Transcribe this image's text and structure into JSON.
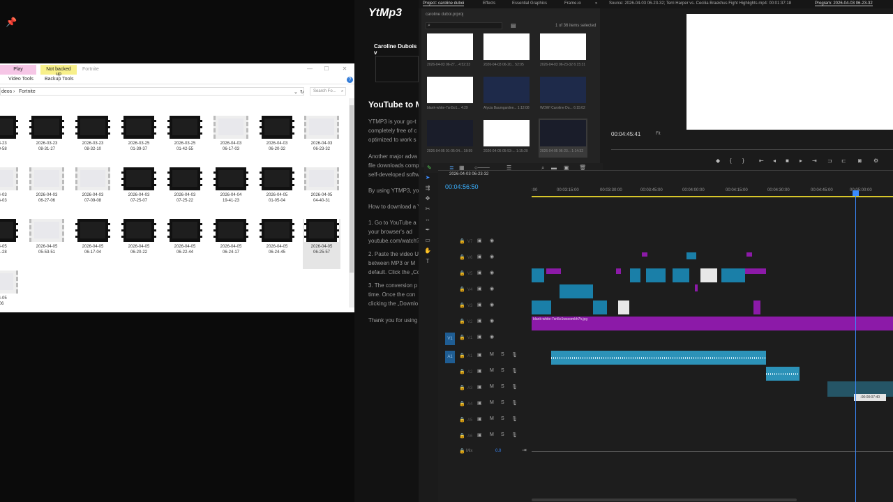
{
  "explorer": {
    "ctx_play": "Play",
    "ctx_backup": "Not backed up",
    "title": "Fortnite",
    "tabs": [
      "Video Tools",
      "Backup Tools"
    ],
    "breadcrumb_parent": "deos",
    "breadcrumb_sep": "›",
    "breadcrumb_current": "Fortnite",
    "search_placeholder": "Search Fo...",
    "files": [
      {
        "label": "-03-23\n-30-58",
        "light": false
      },
      {
        "label": "2026-03-23\n08-31-27",
        "light": false
      },
      {
        "label": "2026-03-23\n08-32-10",
        "light": false
      },
      {
        "label": "2026-03-25\n01-39-37",
        "light": false
      },
      {
        "label": "2026-03-25\n01-42-55",
        "light": false
      },
      {
        "label": "2026-04-03\n06-17-03",
        "light": true
      },
      {
        "label": "2026-04-03\n06-20-32",
        "light": false
      },
      {
        "label": "2026-04-03\n06-23-32",
        "light": true
      },
      {
        "label": "-04-03\n-26-03",
        "light": true
      },
      {
        "label": "2026-04-03\n06-27-06",
        "light": true
      },
      {
        "label": "2026-04-03\n07-09-08",
        "light": true
      },
      {
        "label": "2026-04-03\n07-25-07",
        "light": false
      },
      {
        "label": "2026-04-03\n07-25-22",
        "light": false
      },
      {
        "label": "2026-04-04\n19-41-23",
        "light": false
      },
      {
        "label": "2026-04-05\n01-05-04",
        "light": false
      },
      {
        "label": "2026-04-05\n04-40-31",
        "light": true
      },
      {
        "label": "-04-05\n-41-28",
        "light": false
      },
      {
        "label": "2026-04-05\n05-53-51",
        "light": true
      },
      {
        "label": "2026-04-05\n06-17-04",
        "light": false
      },
      {
        "label": "2026-04-05\n06-20-22",
        "light": false
      },
      {
        "label": "2026-04-05\n06-22-44",
        "light": false
      },
      {
        "label": "2026-04-05\n06-24-17",
        "light": false
      },
      {
        "label": "2026-04-05\n06-24-45",
        "light": false
      },
      {
        "label": "2026-04-05\n06-25-57",
        "light": false
      },
      {
        "label": "-04-05\n-06",
        "light": true
      }
    ]
  },
  "web": {
    "logo": "YtMp3",
    "user": "Caroline Dubois v",
    "heading": "YouTube to M",
    "paragraphs": [
      "YTMP3 is your go-t",
      "completely free of c",
      "optimized to work s",
      "Another major adva",
      "file downloads comp",
      "self-developed softw",
      "By using YTMP3, yo",
      "How to download a Y",
      "1. Go to YouTube a",
      "your browser's ad",
      "youtube.com/watch?",
      "2. Paste the video U",
      "between MP3 or M",
      "default. Click the „Co",
      "3. The conversion p",
      "time. Once the con",
      "clicking the „Downlo",
      "Thank you for using"
    ]
  },
  "premiere": {
    "tabs": {
      "project": "Project: caroline duboi",
      "effects": "Effects",
      "essential": "Essential Graphics",
      "frame": "Frame.io",
      "source": "Source: 2026-04-03 06-23-32; Terri Harper vs. Cecilia Braekhus  Fight Highlights.mp4: 00:01:37:18",
      "program": "Program: 2026-04-03 06-23-32"
    },
    "project_file": "caroline duboi.prproj",
    "items_count": "1 of 36 items selected",
    "project_items": [
      {
        "label": "2026-04-03 06-27...  4:52:33",
        "style": "light"
      },
      {
        "label": "2026-04-03 06-20...  52:05",
        "style": "light"
      },
      {
        "label": "2026-04-03 06-23-32  6:15:31",
        "style": "light"
      },
      {
        "label": "blank-white-7sn5o1...  4:29",
        "style": "light"
      },
      {
        "label": "Alycia Baumgardne...  1:12:08",
        "style": "blue"
      },
      {
        "label": "WOW! Caroline Du...  6:15:02",
        "style": "blue"
      },
      {
        "label": "2026-04-05 01-05-04...  18:59",
        "style": "dark"
      },
      {
        "label": "2026-04-05 05-53-...  1:15:20",
        "style": "light"
      },
      {
        "label": "2026-04-05 06-23...  1:14:32",
        "style": "dark"
      }
    ],
    "program_tc": "00:04:45:41",
    "fit": "Fit",
    "sequence_name": "2026-04-03 06-23-32",
    "timeline_tc": "00:04:56:50",
    "ruler_marks": [
      ":00",
      "00:03:15:00",
      "00:03:30:00",
      "00:03:45:00",
      "00:04:00:00",
      "00:04:15:00",
      "00:04:30:00",
      "00:04:45:00",
      "00:05:00:00"
    ],
    "video_tracks": [
      "V7",
      "V6",
      "V5",
      "V4",
      "V3",
      "V2",
      "V1"
    ],
    "audio_tracks": [
      "A1",
      "A2",
      "A3",
      "A4",
      "A5",
      "A6"
    ],
    "clip_label": "blank-white-7sn5o1wsoomkh7h.jpg",
    "tooltip": "-00:00:07:40",
    "mix_label": "Mix",
    "mix_value": "0.0"
  }
}
